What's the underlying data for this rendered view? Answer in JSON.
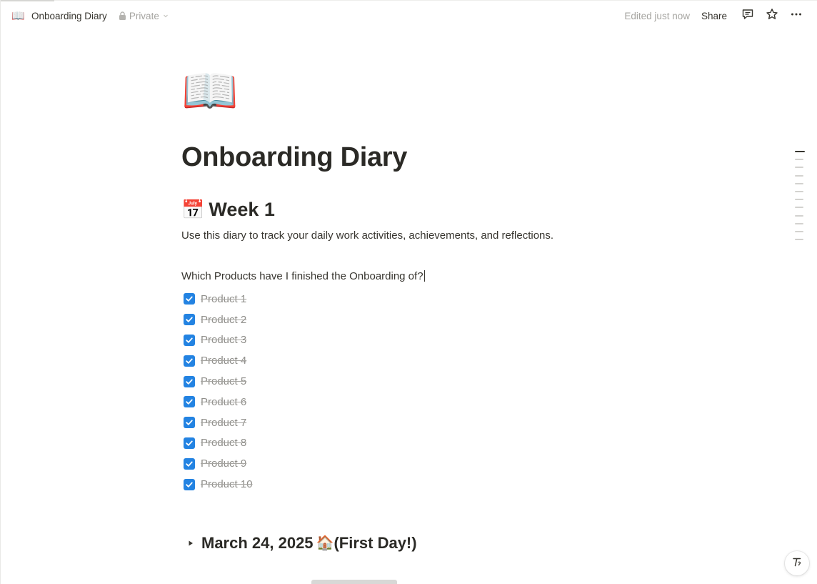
{
  "header": {
    "page_icon": "📖",
    "page_title": "Onboarding Diary",
    "privacy_label": "Private",
    "edited_status": "Edited just now",
    "share_label": "Share",
    "icons": [
      "lock-icon",
      "chevron-down-icon",
      "comment-icon",
      "star-icon",
      "more-icon"
    ]
  },
  "page": {
    "icon": "📖",
    "title": "Onboarding Diary",
    "heading": {
      "emoji": "📅",
      "text": "Week 1"
    },
    "intro": "Use this diary to track your daily work activities, achievements, and reflections.",
    "question": "Which Products have I finished the Onboarding of?",
    "todos": [
      {
        "label": "Product 1",
        "checked": true
      },
      {
        "label": "Product 2",
        "checked": true
      },
      {
        "label": "Product 3",
        "checked": true
      },
      {
        "label": "Product 4",
        "checked": true
      },
      {
        "label": "Product 5",
        "checked": true
      },
      {
        "label": "Product 6",
        "checked": true
      },
      {
        "label": "Product 7",
        "checked": true
      },
      {
        "label": "Product 8",
        "checked": true
      },
      {
        "label": "Product 9",
        "checked": true
      },
      {
        "label": "Product 10",
        "checked": true
      }
    ],
    "toggle": {
      "date": "March 24, 2025",
      "emoji": "🏠",
      "note": "(First Day!)",
      "collapsed": true
    }
  },
  "colors": {
    "checkbox_blue": "#2383e2",
    "text_primary": "#37352f",
    "text_muted": "#a6a5a1"
  },
  "help_icon": "help-icon"
}
